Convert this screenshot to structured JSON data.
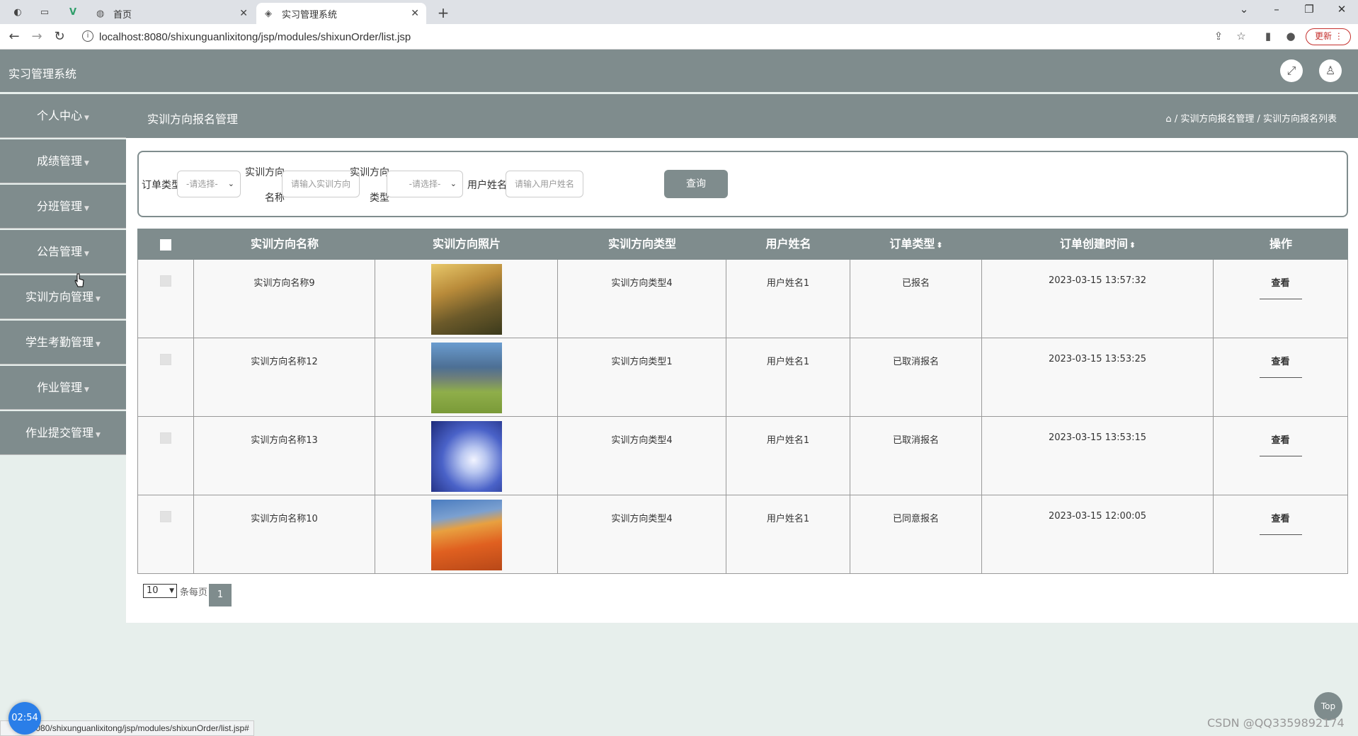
{
  "browser": {
    "tabs": [
      {
        "title": "首页"
      },
      {
        "title": "实习管理系统"
      }
    ],
    "url": "localhost:8080/shixunguanlixitong/jsp/modules/shixunOrder/list.jsp",
    "update_label": "更新",
    "status_url": "lo.../8080/shixunguanlixitong/jsp/modules/shixunOrder/list.jsp#"
  },
  "app": {
    "title": "实习管理系统"
  },
  "sidebar": {
    "items": [
      {
        "label": "个人中心"
      },
      {
        "label": "成绩管理"
      },
      {
        "label": "分班管理"
      },
      {
        "label": "公告管理"
      },
      {
        "label": "实训方向管理"
      },
      {
        "label": "学生考勤管理"
      },
      {
        "label": "作业管理"
      },
      {
        "label": "作业提交管理"
      }
    ]
  },
  "page": {
    "title": "实训方向报名管理",
    "breadcrumb": "/ 实训方向报名管理 / 实训方向报名列表"
  },
  "search": {
    "order_type_label": "订单类型",
    "order_type_value": "-请选择-",
    "name_label_1": "实训方向",
    "name_label_2": "名称",
    "name_placeholder": "请输入实训方向",
    "type_label_1": "实训方向",
    "type_label_2": "类型",
    "type_value": "-请选择-",
    "user_label": "用户姓名",
    "user_placeholder": "请输入用户姓名",
    "query_label": "查询"
  },
  "table": {
    "headers": [
      "实训方向名称",
      "实训方向照片",
      "实训方向类型",
      "用户姓名",
      "订单类型",
      "订单创建时间",
      "操作"
    ],
    "rows": [
      {
        "name": "实训方向名称9",
        "type": "实训方向类型4",
        "user": "用户姓名1",
        "status": "已报名",
        "time": "2023-03-15 13:57:32",
        "action": "查看"
      },
      {
        "name": "实训方向名称12",
        "type": "实训方向类型1",
        "user": "用户姓名1",
        "status": "已取消报名",
        "time": "2023-03-15 13:53:25",
        "action": "查看"
      },
      {
        "name": "实训方向名称13",
        "type": "实训方向类型4",
        "user": "用户姓名1",
        "status": "已取消报名",
        "time": "2023-03-15 13:53:15",
        "action": "查看"
      },
      {
        "name": "实训方向名称10",
        "type": "实训方向类型4",
        "user": "用户姓名1",
        "status": "已同意报名",
        "time": "2023-03-15 12:00:05",
        "action": "查看"
      }
    ]
  },
  "pager": {
    "page_size": "10",
    "per_page_label": "条每页",
    "current_page": "1"
  },
  "overlay": {
    "top_label": "Top",
    "timer": "02:54",
    "watermark": "CSDN @QQ3359892174"
  },
  "colors": {
    "theme": "#7f8c8d",
    "background": "#e7efec"
  }
}
